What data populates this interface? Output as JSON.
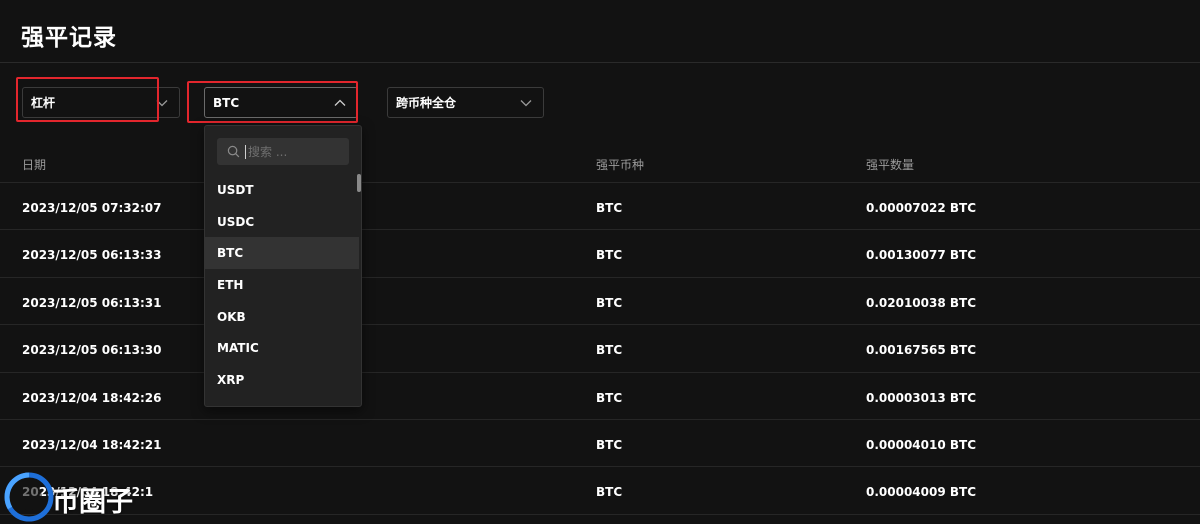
{
  "page": {
    "title": "强平记录"
  },
  "filters": {
    "leverage": {
      "value": "杠杆"
    },
    "currency": {
      "value": "BTC"
    },
    "cross_margin": {
      "value": "跨币种全仓"
    }
  },
  "dropdown": {
    "search_placeholder": "搜索 ...",
    "options": [
      "USDT",
      "USDC",
      "BTC",
      "ETH",
      "OKB",
      "MATIC",
      "XRP"
    ],
    "selected": "BTC"
  },
  "table": {
    "headers": {
      "date": "日期",
      "coin": "强平币种",
      "amount": "强平数量"
    },
    "rows": [
      {
        "date": "2023/12/05 07:32:07",
        "coin": "BTC",
        "amount": "0.00007022 BTC"
      },
      {
        "date": "2023/12/05 06:13:33",
        "coin": "BTC",
        "amount": "0.00130077 BTC"
      },
      {
        "date": "2023/12/05 06:13:31",
        "coin": "BTC",
        "amount": "0.02010038 BTC"
      },
      {
        "date": "2023/12/05 06:13:30",
        "coin": "BTC",
        "amount": "0.00167565 BTC"
      },
      {
        "date": "2023/12/04 18:42:26",
        "coin": "BTC",
        "amount": "0.00003013 BTC"
      },
      {
        "date": "2023/12/04 18:42:21",
        "coin": "BTC",
        "amount": "0.00004010 BTC"
      },
      {
        "date": "2023/12/04 18:42:1",
        "coin": "BTC",
        "amount": "0.00004009 BTC"
      }
    ]
  },
  "watermark": {
    "text": "币圈子"
  },
  "colors": {
    "background": "#121212",
    "highlight": "#e3262d",
    "dropdown_bg": "#222222",
    "muted_text": "#9a9a9a"
  }
}
